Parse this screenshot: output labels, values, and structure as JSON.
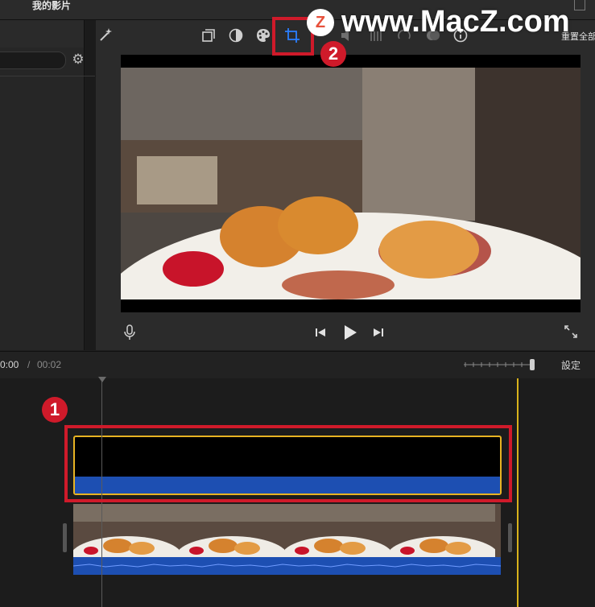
{
  "window": {
    "title": "我的影片"
  },
  "viewer_toolbar": {
    "tools": [
      {
        "name": "magic-wand-icon"
      },
      {
        "name": "crop-to-fill-icon"
      },
      {
        "name": "color-balance-icon"
      },
      {
        "name": "color-palette-icon"
      },
      {
        "name": "crop-icon",
        "active": true
      },
      {
        "name": "stabilization-icon"
      },
      {
        "name": "volume-icon"
      },
      {
        "name": "equalizer-icon"
      },
      {
        "name": "speed-icon"
      },
      {
        "name": "filter-icon"
      },
      {
        "name": "info-icon"
      }
    ],
    "reset_all_label": "重置全部"
  },
  "playback": {
    "current_time": "0:00",
    "separator": "/",
    "total_time": "00:02"
  },
  "timeline": {
    "settings_label": "設定"
  },
  "annotations": {
    "badge_1": "1",
    "badge_2": "2"
  },
  "watermark": {
    "logo_letter": "Z",
    "text": "www.MacZ.com"
  },
  "colors": {
    "accent_blue": "#2a7fff",
    "clip_border": "#e7b323",
    "audio_blue": "#1d4fb2",
    "callout_red": "#cf1a2a"
  }
}
